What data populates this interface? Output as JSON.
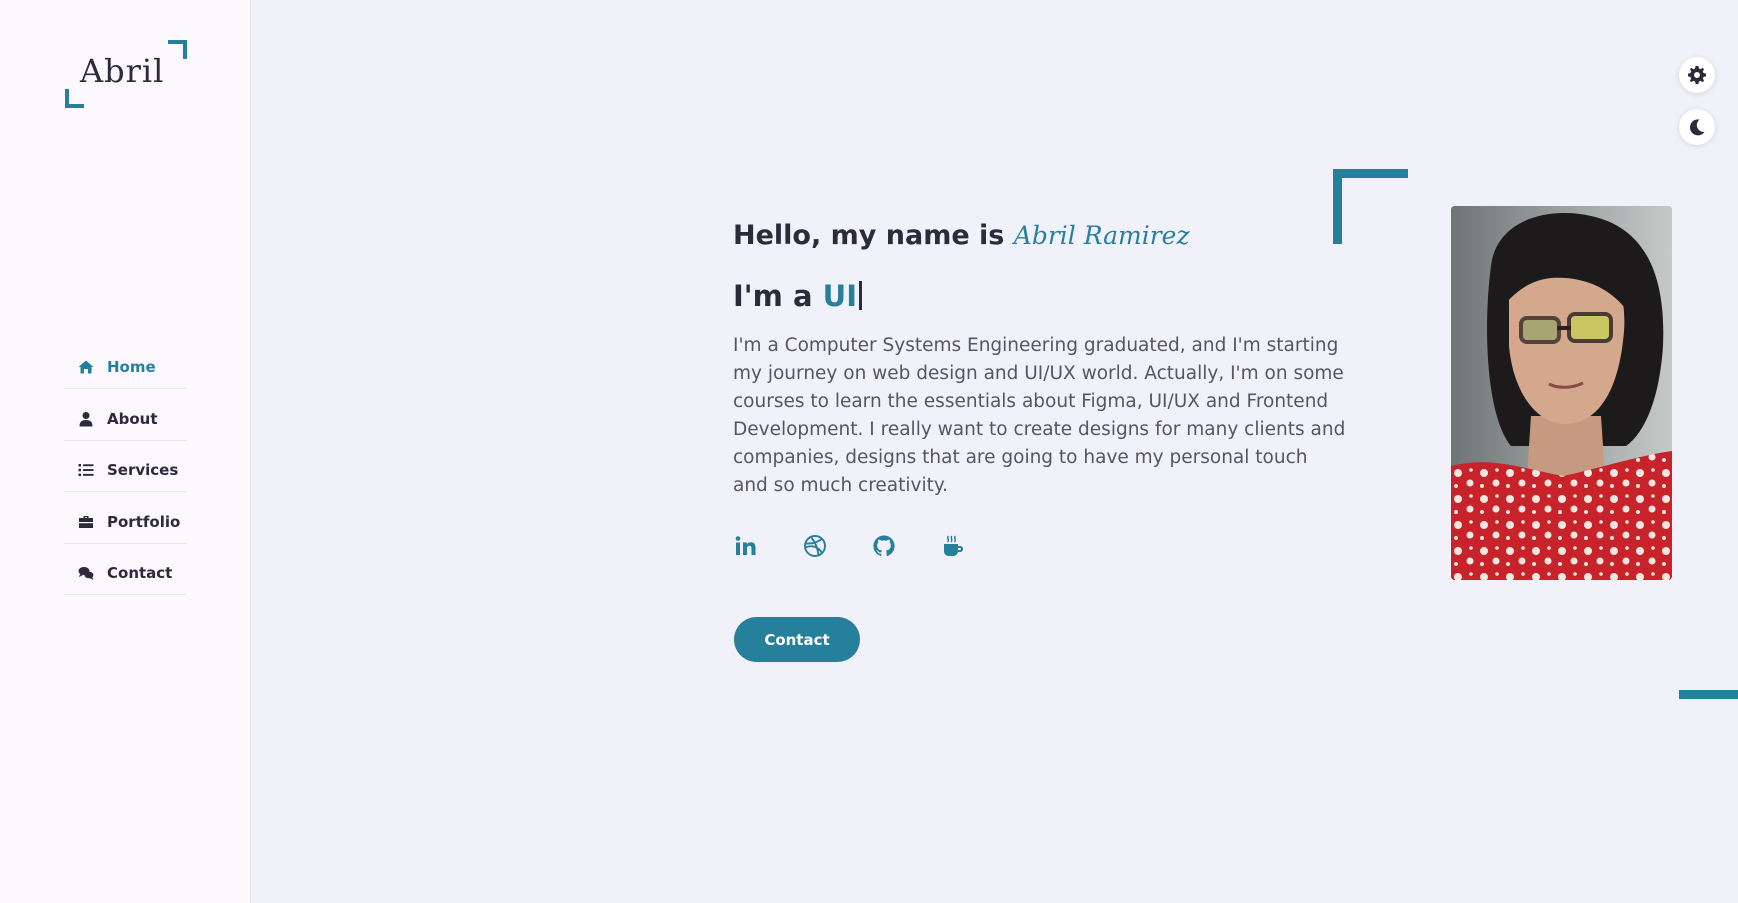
{
  "sidebar": {
    "logo_text": "Abril",
    "nav": [
      {
        "label": "Home",
        "icon": "home-icon",
        "active": true
      },
      {
        "label": "About",
        "icon": "user-icon",
        "active": false
      },
      {
        "label": "Services",
        "icon": "list-icon",
        "active": false
      },
      {
        "label": "Portfolio",
        "icon": "briefcase-icon",
        "active": false
      },
      {
        "label": "Contact",
        "icon": "chat-icon",
        "active": false
      }
    ]
  },
  "toolbar": {
    "settings_icon": "gear-icon",
    "theme_icon": "moon-icon"
  },
  "hero": {
    "greeting": "Hello, my name is",
    "name": "Abril Ramirez",
    "role_prefix": "I'm a",
    "role": "UI",
    "bio": "I'm a Computer Systems Engineering graduated, and I'm starting my journey on web design and UI/UX world. Actually, I'm on some courses to learn the essentials about Figma, UI/UX and Frontend Development. I really want to create designs for many clients and companies, designs that are going to have my personal touch and so much creativity.",
    "socials": [
      "linkedin-icon",
      "dribbble-icon",
      "github-icon",
      "coffee-icon"
    ],
    "contact_label": "Contact"
  },
  "colors": {
    "accent": "#26809c",
    "text": "#2b2b3b",
    "background": "#f1f1f9",
    "sidebar": "#fcf8fd"
  }
}
